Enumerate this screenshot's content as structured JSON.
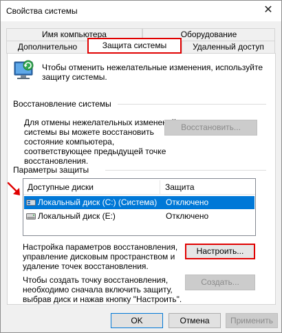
{
  "window": {
    "title": "Свойства системы",
    "close_label": "✕"
  },
  "tabs": {
    "row1": [
      "Имя компьютера",
      "Оборудование"
    ],
    "row2": [
      "Дополнительно",
      "Защита системы",
      "Удаленный доступ"
    ],
    "active": "Защита системы"
  },
  "intro": {
    "line1": "Чтобы отменить нежелательные изменения, используйте",
    "line2": "защиту системы."
  },
  "restore": {
    "group_label": "Восстановление системы",
    "lines": [
      "Для отмены нежелательных изменений",
      "системы вы можете восстановить",
      "состояние компьютера,",
      "соответствующее предыдущей точке",
      "восстановления."
    ],
    "button_label": "Восстановить..."
  },
  "protection": {
    "group_label": "Параметры защиты",
    "columns": [
      "Доступные диски",
      "Защита"
    ],
    "rows": [
      {
        "disk": "Локальный диск (C:) (Система)",
        "status": "Отключено",
        "selected": true
      },
      {
        "disk": "Локальный диск (E:)",
        "status": "Отключено",
        "selected": false
      }
    ]
  },
  "configure": {
    "lines": [
      "Настройка параметров восстановления,",
      "управление дисковым пространством и",
      "удаление точек восстановления."
    ],
    "button_label": "Настроить..."
  },
  "create": {
    "lines": [
      "Чтобы создать точку восстановления,",
      "необходимо сначала включить защиту,",
      "выбрав диск и нажав кнопку \"Настроить\"."
    ],
    "button_label": "Создать..."
  },
  "footer": {
    "ok_label": "OK",
    "cancel_label": "Отмена",
    "apply_label": "Применить"
  },
  "colors": {
    "highlight": "#e00000",
    "selection": "#0078d7"
  }
}
